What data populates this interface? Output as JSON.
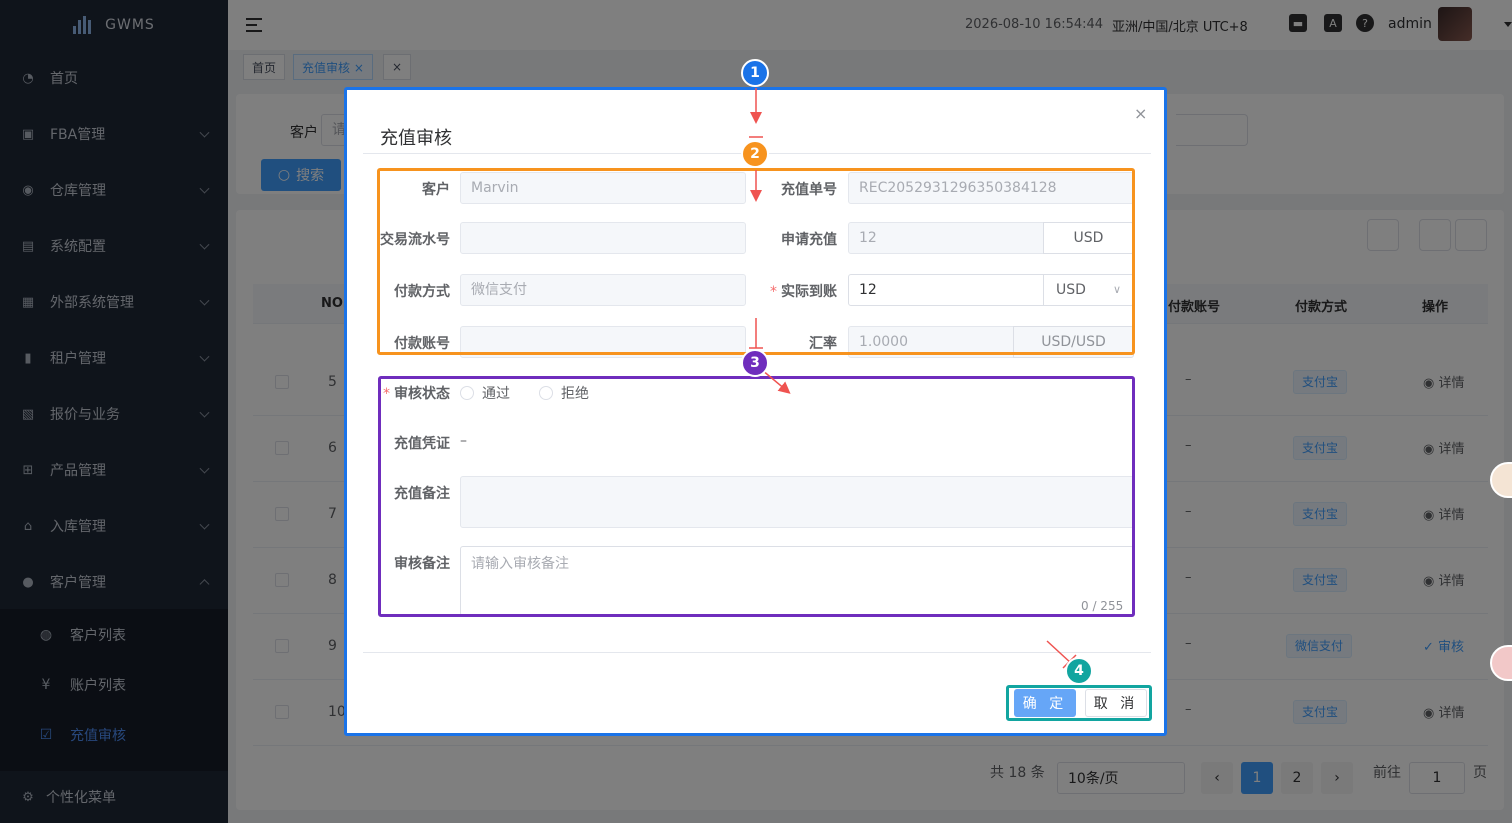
{
  "app": {
    "name": "GWMS"
  },
  "sidebar": {
    "items": [
      {
        "label": "首页",
        "icon": "dashboard-icon"
      },
      {
        "label": "FBA管理",
        "icon": "box-icon"
      },
      {
        "label": "仓库管理",
        "icon": "globe-icon"
      },
      {
        "label": "系统配置",
        "icon": "config-icon"
      },
      {
        "label": "外部系统管理",
        "icon": "grid-icon"
      },
      {
        "label": "租户管理",
        "icon": "bar-chart-icon"
      },
      {
        "label": "报价与业务",
        "icon": "document-icon"
      },
      {
        "label": "产品管理",
        "icon": "cart-icon"
      },
      {
        "label": "入库管理",
        "icon": "home-icon"
      },
      {
        "label": "客户管理",
        "icon": "user-icon"
      }
    ],
    "sub_items": [
      {
        "label": "客户列表",
        "icon": "customer-icon"
      },
      {
        "label": "账户列表",
        "icon": "yen-icon"
      },
      {
        "label": "充值审核",
        "icon": "check-square-icon"
      }
    ],
    "bottom": {
      "label": "个性化菜单",
      "icon": "gear-icon"
    }
  },
  "header": {
    "datetime": "2026-08-10 16:54:44",
    "timezone": "亚洲/中国/北京 UTC+8",
    "translate_icon_text": "A",
    "help_icon_text": "?",
    "username": "admin"
  },
  "tags": [
    {
      "label": "首页"
    },
    {
      "label": "充值审核 ×"
    },
    {
      "label": "×"
    }
  ],
  "filter": {
    "customer_label": "客户",
    "customer_placeholder": "请",
    "search_label": "搜索"
  },
  "table": {
    "headers": {
      "no": "NO.",
      "account": "付款账号",
      "method": "付款方式",
      "op": "操作"
    },
    "rows": [
      {
        "no": "5",
        "account": "–",
        "method": "支付宝",
        "op": "详情"
      },
      {
        "no": "6",
        "account": "–",
        "method": "支付宝",
        "op": "详情"
      },
      {
        "no": "7",
        "account": "–",
        "method": "支付宝",
        "op": "详情"
      },
      {
        "no": "8",
        "account": "–",
        "method": "支付宝",
        "op": "详情"
      },
      {
        "no": "9",
        "account": "–",
        "method": "微信支付",
        "op": "审核"
      },
      {
        "no": "10",
        "account": "–",
        "method": "支付宝",
        "op": "详情"
      }
    ]
  },
  "pagination": {
    "total": "共 18 条",
    "page_size": "10条/页",
    "pages": [
      "1",
      "2"
    ],
    "goto_label": "前往",
    "goto_value": "1",
    "page_unit": "页"
  },
  "dialog": {
    "title": "充值审核",
    "close": "×",
    "fields": {
      "customer": {
        "label": "客户",
        "value": "Marvin"
      },
      "order_no": {
        "label": "充值单号",
        "value": "REC2052931296350384128"
      },
      "txn_no": {
        "label": "交易流水号",
        "value": ""
      },
      "apply_amount": {
        "label": "申请充值",
        "value": "12",
        "currency": "USD"
      },
      "pay_method": {
        "label": "付款方式",
        "value": "微信支付"
      },
      "actual_amount": {
        "label": "实际到账",
        "value": "12",
        "currency": "USD"
      },
      "pay_account": {
        "label": "付款账号",
        "value": ""
      },
      "rate": {
        "label": "汇率",
        "value": "1.0000",
        "pair": "USD/USD"
      },
      "audit_status": {
        "label": "审核状态",
        "options": [
          "通过",
          "拒绝"
        ]
      },
      "voucher": {
        "label": "充值凭证",
        "value": "–"
      },
      "remark": {
        "label": "充值备注",
        "value": ""
      },
      "audit_remark": {
        "label": "审核备注",
        "placeholder": "请输入审核备注",
        "counter": "0 / 255"
      }
    },
    "buttons": {
      "ok": "确 定",
      "cancel": "取 消"
    }
  },
  "annotations": [
    {
      "number": "1",
      "color": "#1a73e8"
    },
    {
      "number": "2",
      "color": "#f7931e"
    },
    {
      "number": "3",
      "color": "#6f2dbd"
    },
    {
      "number": "4",
      "color": "#12a5a0"
    }
  ]
}
